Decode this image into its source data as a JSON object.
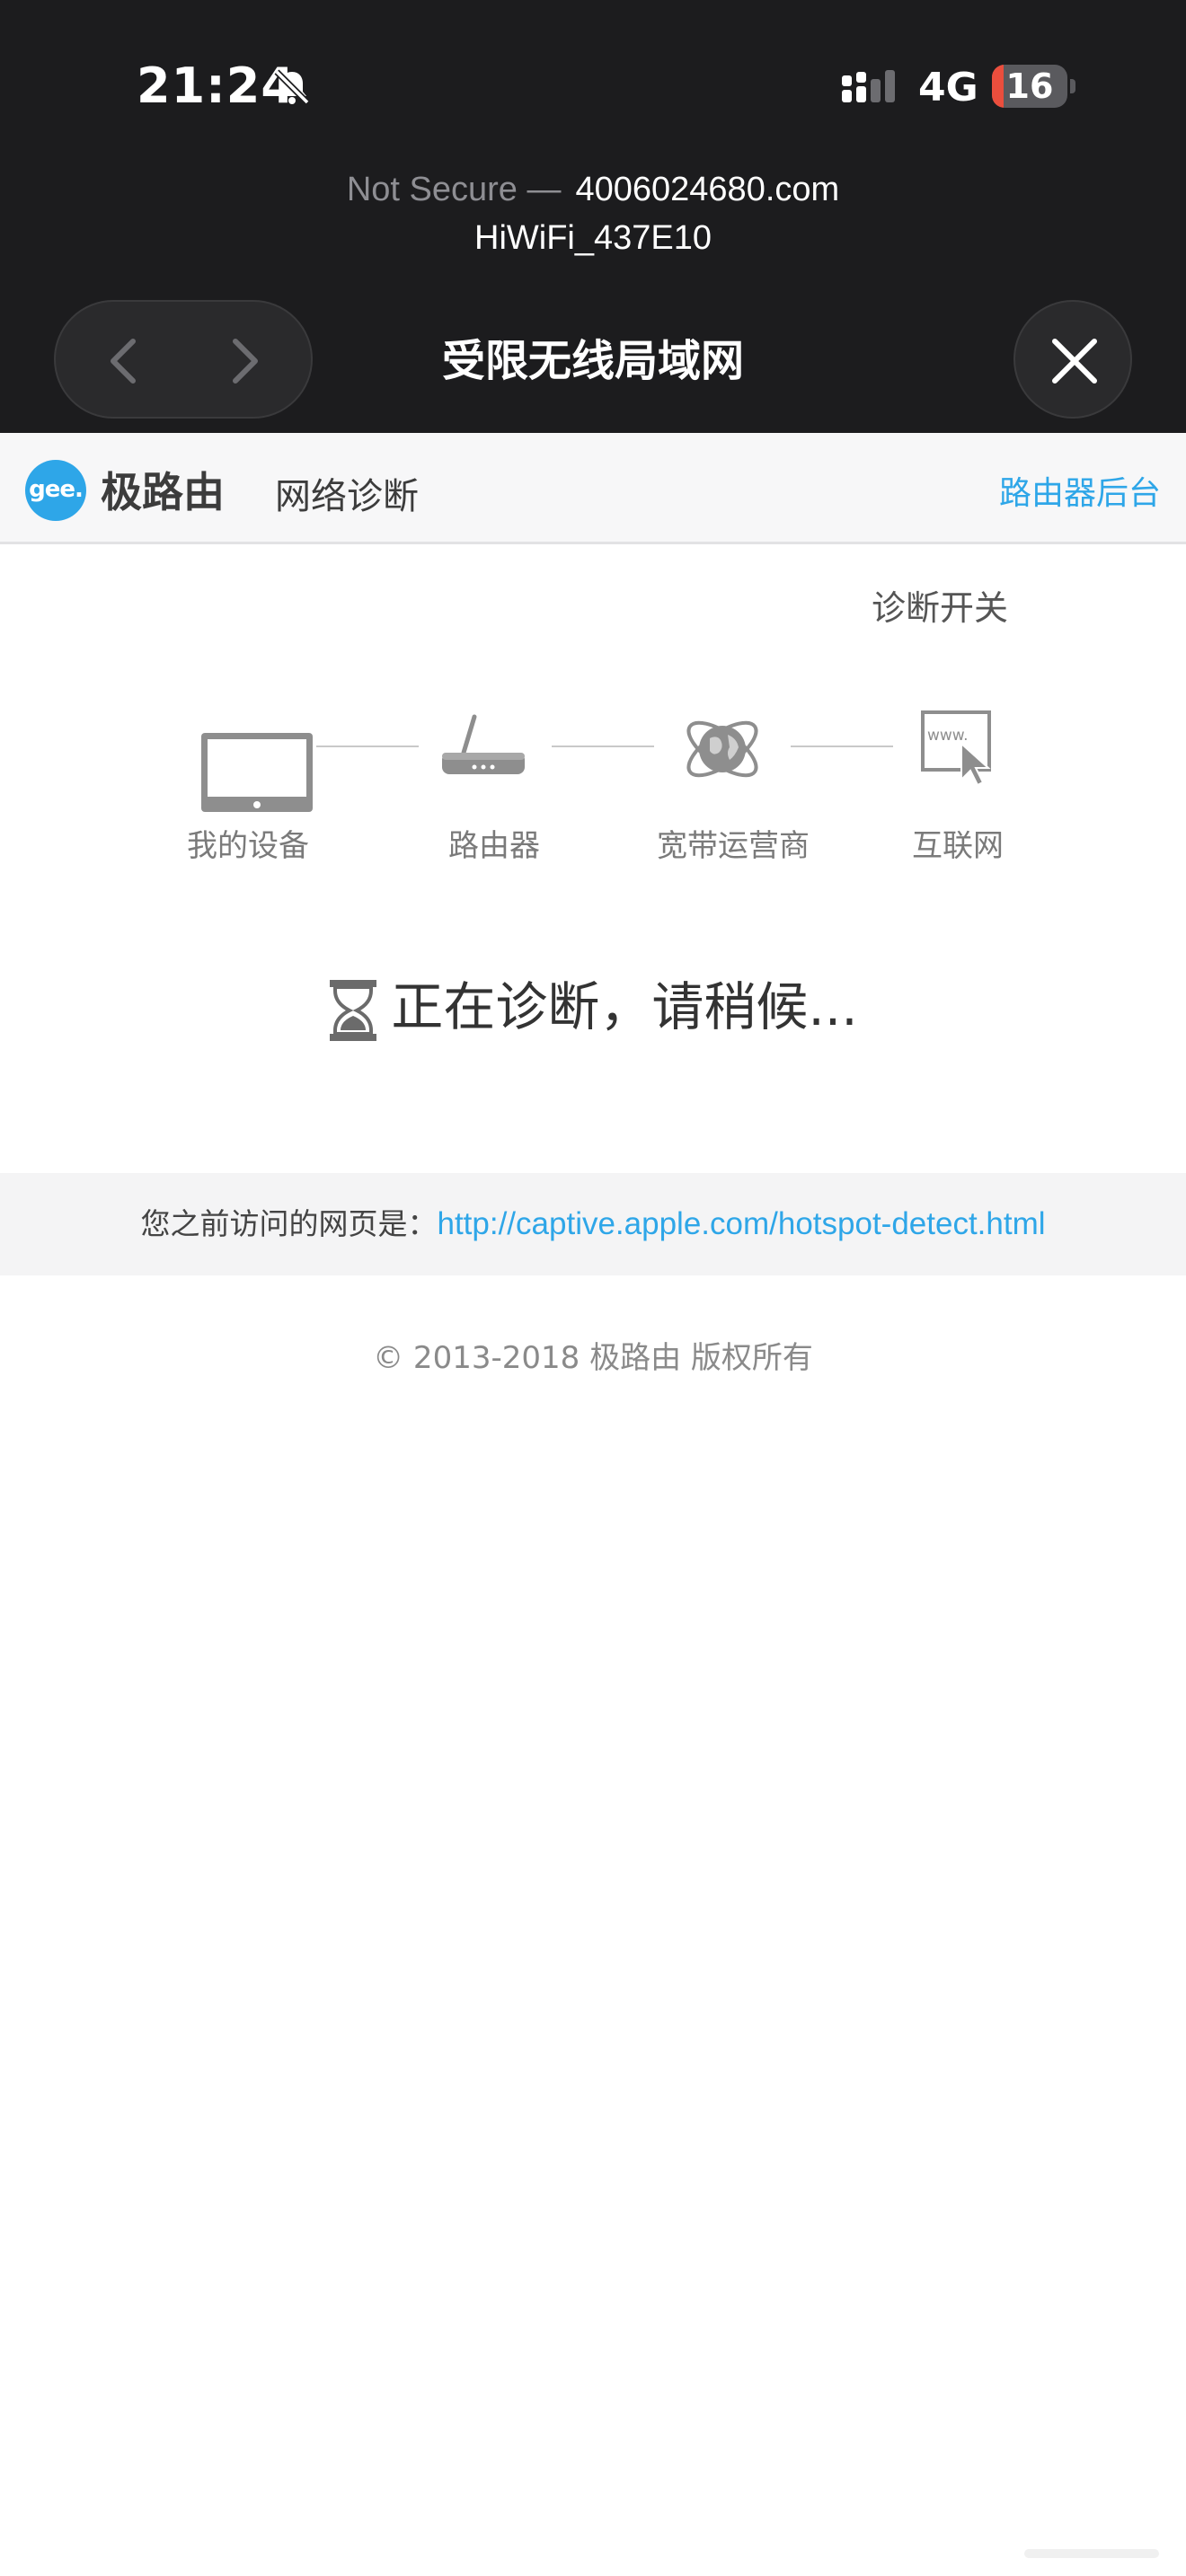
{
  "status_bar": {
    "time": "21:24",
    "network_type": "4G",
    "battery_level": "16",
    "battery_fraction": 0.16,
    "icons": [
      "bell-slash-icon",
      "signal-icon"
    ]
  },
  "captive_sheet": {
    "not_secure": "Not Secure —",
    "domain": "4006024680.com",
    "network_name": "HiWiFi_437E10",
    "title": "受限无线局域网",
    "icons": [
      "chevron-left-icon",
      "chevron-right-icon",
      "close-icon"
    ]
  },
  "header": {
    "logo_text": "gee.",
    "brand": "极路由",
    "page_title": "网络诊断",
    "admin_link": "路由器后台"
  },
  "main": {
    "switch_label": "诊断开关",
    "nodes": [
      {
        "label": "我的设备",
        "icon": "monitor-icon"
      },
      {
        "label": "路由器",
        "icon": "router-icon"
      },
      {
        "label": "宽带运营商",
        "icon": "globe-icon"
      },
      {
        "label": "互联网",
        "icon": "www-cursor-icon"
      }
    ],
    "status_text": "正在诊断，请稍候...",
    "status_icon": "hourglass-icon",
    "prev_visit_label": "您之前访问的网页是：",
    "prev_visit_url": "http://captive.apple.com/hotspot-detect.html",
    "copyright": "© 2013-2018 极路由 版权所有"
  },
  "colors": {
    "accent": "#2ea6e8",
    "dark_bar": "#1c1c1e",
    "battery_low": "#eb4e3d"
  }
}
